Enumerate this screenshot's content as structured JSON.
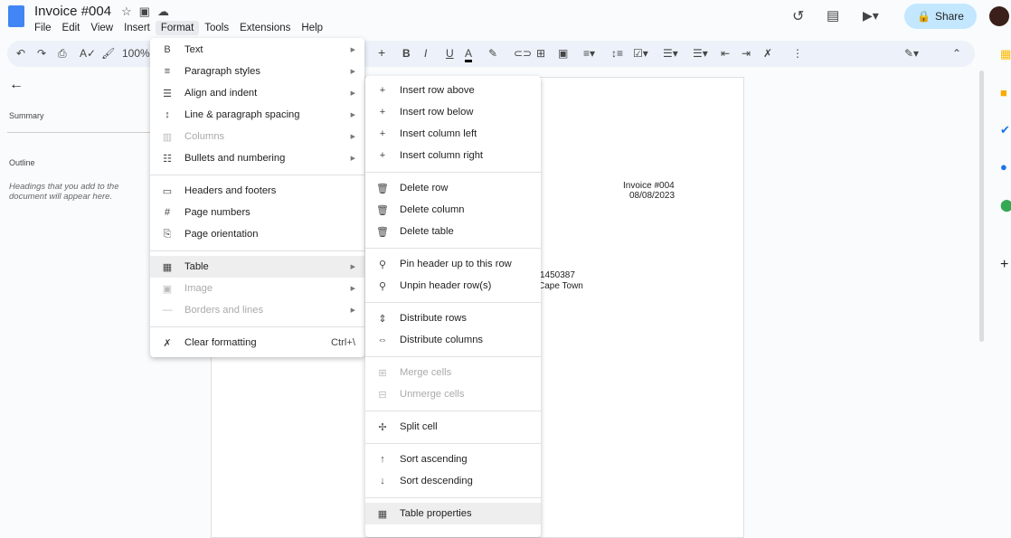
{
  "header": {
    "title": "Invoice #004",
    "menus": [
      "File",
      "Edit",
      "View",
      "Insert",
      "Format",
      "Tools",
      "Extensions",
      "Help"
    ],
    "active_menu": "Format",
    "share_label": "Share"
  },
  "toolbar": {
    "zoom": "100%"
  },
  "sidebar": {
    "summary": "Summary",
    "outline": "Outline",
    "outline_hint": "Headings that you add to the document will appear here."
  },
  "document": {
    "invoice_no": "Invoice #004",
    "date": "08/08/2023",
    "line1": "1450387",
    "line2": "Cape Town"
  },
  "format_menu": [
    {
      "label": "Text",
      "icon": "B",
      "submenu": true
    },
    {
      "label": "Paragraph styles",
      "icon": "≡",
      "submenu": true
    },
    {
      "label": "Align and indent",
      "icon": "☰",
      "submenu": true
    },
    {
      "label": "Line & paragraph spacing",
      "icon": "↕",
      "submenu": true
    },
    {
      "label": "Columns",
      "icon": "▥",
      "submenu": true,
      "disabled": true
    },
    {
      "label": "Bullets and numbering",
      "icon": "☷",
      "submenu": true
    },
    {
      "sep": true
    },
    {
      "label": "Headers and footers",
      "icon": "▭"
    },
    {
      "label": "Page numbers",
      "icon": "#"
    },
    {
      "label": "Page orientation",
      "icon": "⎘"
    },
    {
      "sep": true
    },
    {
      "label": "Table",
      "icon": "▦",
      "submenu": true,
      "highlighted": true
    },
    {
      "label": "Image",
      "icon": "▣",
      "submenu": true,
      "disabled": true
    },
    {
      "label": "Borders and lines",
      "icon": "—",
      "submenu": true,
      "disabled": true
    },
    {
      "sep": true
    },
    {
      "label": "Clear formatting",
      "icon": "✗",
      "shortcut": "Ctrl+\\"
    }
  ],
  "table_menu": [
    {
      "label": "Insert row above",
      "icon": "+"
    },
    {
      "label": "Insert row below",
      "icon": "+"
    },
    {
      "label": "Insert column left",
      "icon": "+"
    },
    {
      "label": "Insert column right",
      "icon": "+"
    },
    {
      "sep": true
    },
    {
      "label": "Delete row",
      "icon": "🗑"
    },
    {
      "label": "Delete column",
      "icon": "🗑"
    },
    {
      "label": "Delete table",
      "icon": "🗑"
    },
    {
      "sep": true
    },
    {
      "label": "Pin header up to this row",
      "icon": "⚲"
    },
    {
      "label": "Unpin header row(s)",
      "icon": "⚲"
    },
    {
      "sep": true
    },
    {
      "label": "Distribute rows",
      "icon": "⇕"
    },
    {
      "label": "Distribute columns",
      "icon": "⇔"
    },
    {
      "sep": true
    },
    {
      "label": "Merge cells",
      "icon": "⊞",
      "disabled": true
    },
    {
      "label": "Unmerge cells",
      "icon": "⊟",
      "disabled": true
    },
    {
      "sep": true
    },
    {
      "label": "Split cell",
      "icon": "✢"
    },
    {
      "sep": true
    },
    {
      "label": "Sort ascending",
      "icon": "↑"
    },
    {
      "label": "Sort descending",
      "icon": "↓"
    },
    {
      "sep": true
    },
    {
      "label": "Table properties",
      "icon": "▦",
      "highlighted": true
    }
  ]
}
